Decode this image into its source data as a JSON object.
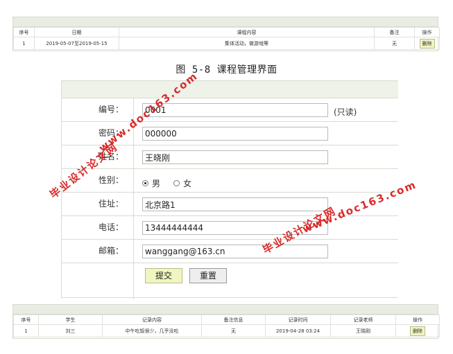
{
  "course_table": {
    "headers": [
      "序号",
      "日期",
      "课程内容",
      "备注",
      "操作"
    ],
    "rows": [
      {
        "index": "1",
        "date": "2019-05-07至2019-05-15",
        "content": "集体活动，做游戏等",
        "remark": "无",
        "action": "删除"
      }
    ]
  },
  "caption": "图 5-8 课程管理界面",
  "form": {
    "id_label": "编号：",
    "id_value": "0001",
    "readonly_note": "(只读)",
    "password_label": "密码：",
    "password_value": "000000",
    "name_label": "姓名：",
    "name_value": "王晓刚",
    "gender_label": "性别：",
    "gender_options": [
      "男",
      "女"
    ],
    "gender_selected": "男",
    "address_label": "住址：",
    "address_value": "北京路1",
    "phone_label": "电话：",
    "phone_value": "13444444444",
    "email_label": "邮箱：",
    "email_value": "wanggang@163.cn",
    "submit_label": "提交",
    "reset_label": "重置"
  },
  "records_table": {
    "headers": [
      "序号",
      "学生",
      "记录内容",
      "备注信息",
      "记录时间",
      "记录老师",
      "操作"
    ],
    "rows": [
      {
        "index": "1",
        "student": "刘三",
        "content": "中午吃饭很少，几乎没吃",
        "remark": "无",
        "time": "2019-04-28 03:24",
        "teacher": "王晓刚",
        "action": "删除"
      }
    ]
  },
  "watermarks": {
    "text_cn": "毕业设计论文网",
    "text_url": "www.doc163.com"
  },
  "colors": {
    "header_bar": "#e8ece3",
    "button_yellow": "#f1f5c2",
    "watermark_red": "#d82020"
  }
}
